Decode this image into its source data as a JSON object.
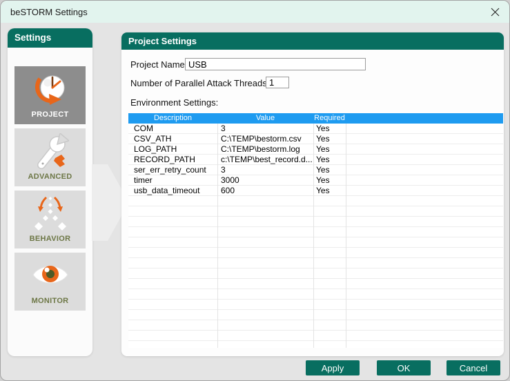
{
  "window": {
    "title": "beSTORM Settings"
  },
  "colors": {
    "accent_teal": "#086E60",
    "titlebar_mint": "#E2F4EE",
    "table_header_blue": "#1E9BF0",
    "selected_tile_gray": "#8D8D8D",
    "tile_gray": "#DCDCDC",
    "tile_label_olive": "#6D7746",
    "icon_orange": "#E8661A"
  },
  "sidebar": {
    "header": "Settings",
    "items": [
      {
        "label": "PROJECT",
        "icon": "clock-arrow-icon",
        "selected": true
      },
      {
        "label": "ADVANCED",
        "icon": "wrench-icon",
        "selected": false
      },
      {
        "label": "BEHAVIOR",
        "icon": "split-diamonds-icon",
        "selected": false
      },
      {
        "label": "MONITOR",
        "icon": "eye-icon",
        "selected": false
      }
    ]
  },
  "main": {
    "header": "Project Settings",
    "project_name_label": "Project Name:",
    "project_name_value": "USB",
    "threads_label": "Number of Parallel Attack Threads:",
    "threads_value": "1",
    "env_label": "Environment Settings:",
    "table": {
      "columns": [
        "Description",
        "Value",
        "Required"
      ],
      "rows": [
        {
          "description": "COM",
          "value": "3",
          "required": "Yes"
        },
        {
          "description": "CSV_ATH",
          "value": "C:\\TEMP\\bestorm.csv",
          "required": "Yes"
        },
        {
          "description": "LOG_PATH",
          "value": "C:\\TEMP\\bestorm.log",
          "required": "Yes"
        },
        {
          "description": "RECORD_PATH",
          "value": "c:\\TEMP\\best_record.d...",
          "required": "Yes"
        },
        {
          "description": "ser_err_retry_count",
          "value": "3",
          "required": "Yes"
        },
        {
          "description": "timer",
          "value": "3000",
          "required": "Yes"
        },
        {
          "description": "usb_data_timeout",
          "value": "600",
          "required": "Yes"
        }
      ]
    }
  },
  "buttons": {
    "apply": "Apply",
    "ok": "OK",
    "cancel": "Cancel"
  }
}
